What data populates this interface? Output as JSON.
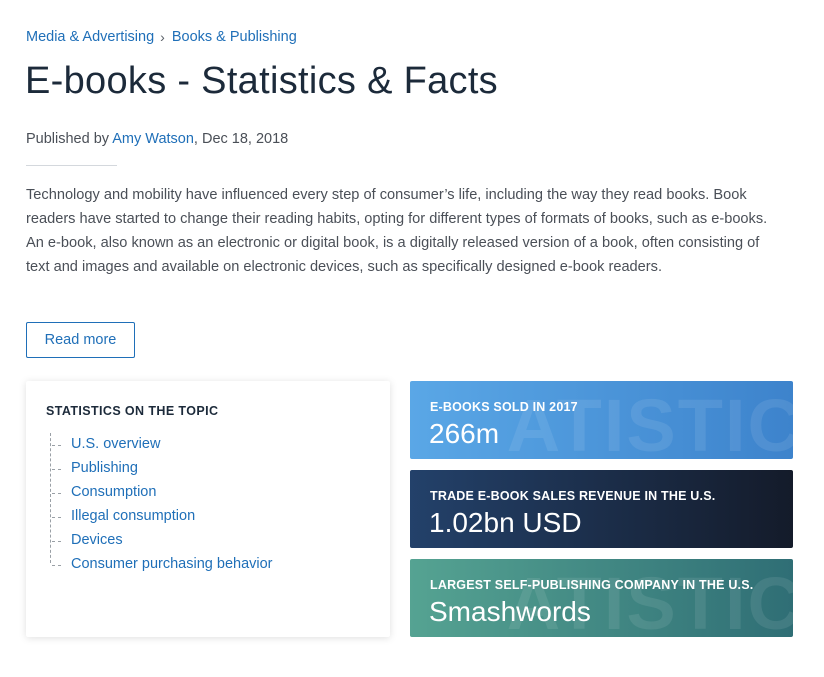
{
  "breadcrumb": {
    "items": [
      "Media & Advertising",
      "Books & Publishing"
    ],
    "separator": "›"
  },
  "page": {
    "title": "E-books - Statistics & Facts",
    "published_prefix": "Published by ",
    "author": "Amy Watson",
    "date": ", Dec 18, 2018",
    "intro": "Technology and mobility have influenced every step of consumer’s life, including the way they read books. Book readers have started to change their reading habits, opting for different types of formats of books, such as e-books. An e-book, also known as an electronic or digital book, is a digitally released version of a book, often consisting of text and images and available on electronic devices, such as specifically designed e-book readers.",
    "read_more_label": "Read more"
  },
  "topics": {
    "heading": "STATISTICS ON THE TOPIC",
    "items": [
      "U.S. overview",
      "Publishing",
      "Consumption",
      "Illegal consumption",
      "Devices",
      "Consumer purchasing behavior"
    ]
  },
  "stats": [
    {
      "label": "E-BOOKS SOLD IN 2017",
      "value": "266m",
      "color": "#4a96dc"
    },
    {
      "label": "TRADE E-BOOK SALES REVENUE IN THE U.S.",
      "value": "1.02bn USD",
      "color": "#1d2c45"
    },
    {
      "label": "LARGEST SELF-PUBLISHING COMPANY IN THE U.S.",
      "value": "Smashwords",
      "color": "#438b86"
    }
  ],
  "colors": {
    "link": "#1f6fb8",
    "title": "#1c2a3a",
    "text": "#4a4f57"
  }
}
